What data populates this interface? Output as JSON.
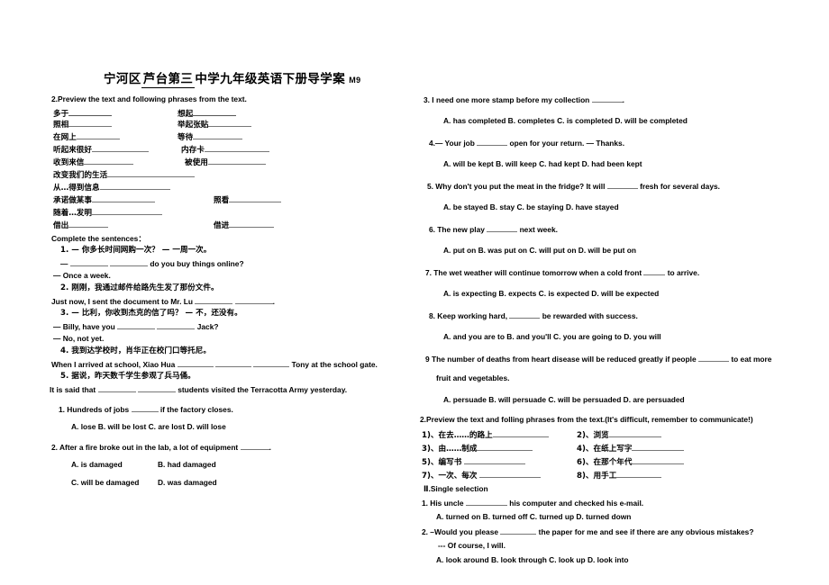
{
  "document": {
    "title_prefix": "宁河区",
    "title_blank": "芦台第三",
    "title_main": "中学九年级英语下册导学案",
    "title_suffix": "M9"
  },
  "left_column": {
    "section1_heading": "2.Preview the text and following phrases from the text.",
    "phrases": [
      {
        "left": "多于",
        "right": "想起"
      },
      {
        "left": "照相",
        "right": "举起张贴"
      },
      {
        "left": "在网上",
        "right": "等待"
      },
      {
        "left": "听起来很好",
        "right": "内存卡"
      },
      {
        "left": "收到来信",
        "right": "被使用"
      },
      {
        "left": "改变我们的生活",
        "right": ""
      },
      {
        "left": "从…得到信息",
        "right": ""
      },
      {
        "left": "承诺做某事",
        "right": "照看"
      },
      {
        "left": "随着…发明",
        "right": ""
      },
      {
        "left": "借出",
        "right": "借进"
      }
    ],
    "complete_heading": "Complete the sentences：",
    "items": [
      {
        "num": "1.",
        "cn": "— 你多长时间网购一次？     — 一周一次。"
      },
      {
        "num": "",
        "en_prefix": "—",
        "en_suffix": "do you buy things online?"
      },
      {
        "num": "",
        "en": "— Once a week."
      },
      {
        "num": "2.",
        "cn": "刚刚，我通过邮件给路先生发了那份文件。"
      },
      {
        "num": "",
        "en_prefix": "Just now, I sent the document to Mr. Lu",
        "en_suffix": "."
      },
      {
        "num": "3.",
        "cn": "— 比利，你收到杰克的信了吗？  — 不，还没有。"
      },
      {
        "num": "",
        "en_prefix": "— Billy, have you",
        "en_suffix": "Jack?"
      },
      {
        "num": "",
        "en": "— No, not yet."
      },
      {
        "num": "4.",
        "cn": "我到达学校时，肖华正在校门口等托尼。"
      },
      {
        "num": "",
        "en_prefix": "When I arrived at school, Xiao Hua",
        "en_suffix": "Tony at the school gate."
      },
      {
        "num": "5.",
        "cn": "据说，昨天数千学生参观了兵马俑。"
      },
      {
        "num": "",
        "en_prefix": "It is said that",
        "en_suffix": "students visited the Terracotta Army yesterday."
      }
    ],
    "mcq": [
      {
        "stem_before": "1. Hundreds of jobs",
        "stem_after": "if the factory closes.",
        "options_line1": "A. lose    B. will be lost     C. are lost    D. will lose"
      },
      {
        "stem_before": "2. After a fire broke out in the lab, a lot of equipment",
        "stem_after": ".",
        "options_line1": "A. is damaged",
        "options_line1b": "B. had damaged",
        "options_line2": "C. will be damaged",
        "options_line2b": "D. was damaged"
      }
    ]
  },
  "right_column": {
    "questions": [
      {
        "stem_before": "3. I need one more stamp before my collection",
        "stem_after": ".",
        "options": "A. has completed          B. completes     C. is completed              D. will be completed"
      },
      {
        "stem_before": "4.— Your job",
        "stem_after": "open for your return.     — Thanks.",
        "options": "A. will be kept    B. will keep    C. had kept D. had been kept"
      },
      {
        "stem_before": "5. Why don't you put the meat in the fridge? It will",
        "stem_after": "fresh for several days.",
        "options": "A. be stayed    B. stay    C. be staying    D. have stayed"
      },
      {
        "stem_before": "6. The new play",
        "stem_after": "next week.",
        "options": "A. put on    B. was put on      C. will put on    D. will be put on"
      },
      {
        "stem_before": "7. The wet weather will continue tomorrow when a cold front",
        "stem_after": "to arrive.",
        "options": "A. is expecting    B. expects    C. is expected    D. will be expected"
      },
      {
        "stem_before": "8. Keep working hard,",
        "stem_after": "be rewarded with success.",
        "options": "A. and you are to    B. and you'll    C. you are going to D. you will"
      },
      {
        "stem_before": "9 The number of deaths from heart disease will be reduced greatly if people",
        "stem_after": "to eat more",
        "stem_line2": "fruit and vegetables.",
        "options": "A. persuade          B. will persuade     C. will be persuaded             D. are persuaded"
      }
    ],
    "section2_heading": "2.Preview the text and folling phrases from the text.(It's difficult, remember to communicate!)",
    "phrases": [
      {
        "left": "1)、在去……的路上",
        "right": "2)、浏览"
      },
      {
        "left": "3)、由……制成",
        "right": "4)、在纸上写字"
      },
      {
        "left": "5)、编写书",
        "right": "6)、在那个年代"
      },
      {
        "left": "7)、一次、每次",
        "right": "8)、用手工"
      }
    ],
    "single_selection_heading": "Ⅱ.Single selection",
    "single_selection": [
      {
        "stem_before": "1. His uncle",
        "stem_after": "his computer and checked his e-mail.",
        "options": "A. turned on    B. turned off    C. turned up          D. turned down"
      },
      {
        "stem_before": "2. –Would you please",
        "stem_after": "the paper for me and see if there are any obvious mistakes?",
        "stem_line2": "--- Of course, I will.",
        "options": "A. look around    B. look through    C. look up    D. look into"
      }
    ]
  }
}
